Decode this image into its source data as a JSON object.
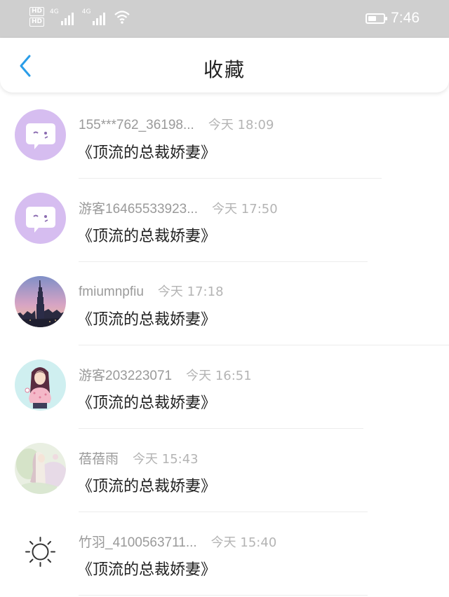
{
  "status_bar": {
    "hd1": "HD",
    "hd2": "HD",
    "signal1": "4G",
    "signal2": "4G",
    "time": "7:46",
    "battery_level": 0.55,
    "icons": [
      "hd-icon",
      "signal-icon",
      "wifi-icon",
      "battery-icon"
    ]
  },
  "header": {
    "back_icon": "chevron-left-icon",
    "title": "收藏",
    "accent_color": "#2a9de8"
  },
  "favorites": [
    {
      "name": "155***762_36198...",
      "time": "今天 18:09",
      "book": "《顶流的总裁娇妻》",
      "avatar": "chat-bubble-avatar"
    },
    {
      "name": "游客16465533923...",
      "time": "今天 17:50",
      "book": "《顶流的总裁娇妻》",
      "avatar": "chat-bubble-avatar"
    },
    {
      "name": "fmiumnpfiu",
      "time": "今天 17:18",
      "book": "《顶流的总裁娇妻》",
      "avatar": "city-tower-avatar"
    },
    {
      "name": "游客203223071",
      "time": "今天 16:51",
      "book": "《顶流的总裁娇妻》",
      "avatar": "girl-illustration-avatar"
    },
    {
      "name": "蓓蓓雨",
      "time": "今天 15:43",
      "book": "《顶流的总裁娇妻》",
      "avatar": "watercolor-avatar"
    },
    {
      "name": "竹羽_4100563711...",
      "time": "今天 15:40",
      "book": "《顶流的总裁娇妻》",
      "avatar": "sun-icon-avatar"
    }
  ]
}
